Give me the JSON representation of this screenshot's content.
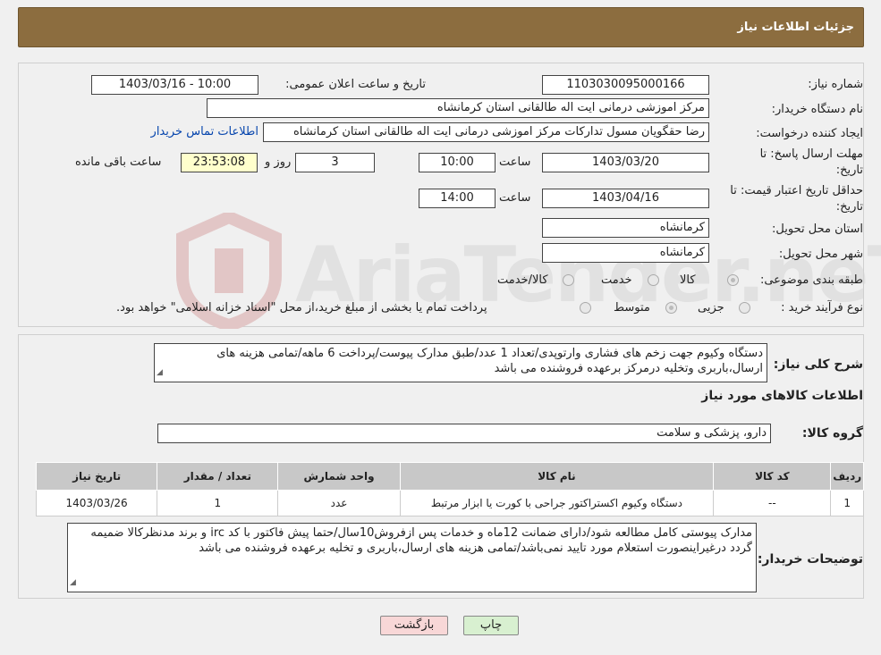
{
  "header": {
    "title": "جزئیات اطلاعات نیاز"
  },
  "form": {
    "need_number_label": "شماره نیاز:",
    "need_number": "1103030095000166",
    "announce_label": "تاریخ و ساعت اعلان عمومی:",
    "announce_value": "1403/03/16 - 10:00",
    "buyer_org_label": "نام دستگاه خریدار:",
    "buyer_org": "مرکز اموزشی درمانی ایت اله طالقانی استان کرمانشاه",
    "creator_label": "ایجاد کننده درخواست:",
    "creator": "رضا حقگویان مسول تدارکات مرکز اموزشی درمانی ایت اله طالقانی استان کرمانشاه",
    "contact_link": "اطلاعات تماس خریدار",
    "deadline_label_1": "مهلت ارسال پاسخ: تا",
    "deadline_label_2": "تاریخ:",
    "deadline_date": "1403/03/20",
    "time_label": "ساعت",
    "deadline_time": "10:00",
    "days": "3",
    "days_label": "روز و",
    "remaining": "23:53:08",
    "remaining_label": "ساعت باقی مانده",
    "validity_label_1": "حداقل تاریخ اعتبار قیمت: تا",
    "validity_label_2": "تاریخ:",
    "validity_date": "1403/04/16",
    "validity_time": "14:00",
    "province_label": "استان محل تحویل:",
    "province": "کرمانشاه",
    "city_label": "شهر محل تحویل:",
    "city": "کرمانشاه",
    "category_label": "طبقه بندی موضوعی:",
    "category_options": [
      "کالا",
      "خدمت",
      "کالا/خدمت"
    ],
    "process_label": "نوع فرآیند خرید :",
    "process_options": [
      "جزیی",
      "متوسط"
    ],
    "process_note": "پرداخت تمام یا بخشی از مبلغ خرید،از محل \"اسناد خزانه اسلامی\" خواهد بود."
  },
  "summary": {
    "label": "شرح کلی نیاز:",
    "text": "دستگاه وکیوم جهت زخم های فشاری وارتوپدی/تعداد 1 عدد/طبق مدارک پیوست/پرداخت 6 ماهه/تمامی هزینه های ارسال،باربری وتخلیه درمرکز برعهده فروشنده می باشد",
    "goods_info_title": "اطلاعات کالاهای مورد نیاز",
    "group_label": "گروه کالا:",
    "group_value": "دارو، پزشکی و سلامت"
  },
  "table": {
    "headers": [
      "ردیف",
      "کد کالا",
      "نام کالا",
      "واحد شمارش",
      "تعداد / مقدار",
      "تاریخ نیاز"
    ],
    "rows": [
      [
        "1",
        "--",
        "دستگاه وکیوم اکستراکتور جراحی با کورت یا ابزار مرتبط",
        "عدد",
        "1",
        "1403/03/26"
      ]
    ]
  },
  "buyer_notes": {
    "label": "توضیحات خریدار:",
    "text": "مدارک پیوستی کامل مطالعه شود/دارای ضمانت 12ماه و خدمات پس ازفروش10سال/حتما پیش فاکتور با کد irc و برند مدنظرکالا ضمیمه گردد درغیراینصورت استعلام مورد تایید نمی‌باشد/تمامی هزینه های ارسال،باربری و تخلیه برعهده فروشنده می باشد"
  },
  "buttons": {
    "print": "چاپ",
    "back": "بازگشت"
  },
  "watermark": "AriaTender.neT",
  "colors": {
    "header_bg": "#8c6d3f",
    "back_btn_bg": "#f8d7d7",
    "print_btn_bg": "#d8f0d0",
    "link": "#0645ad"
  }
}
